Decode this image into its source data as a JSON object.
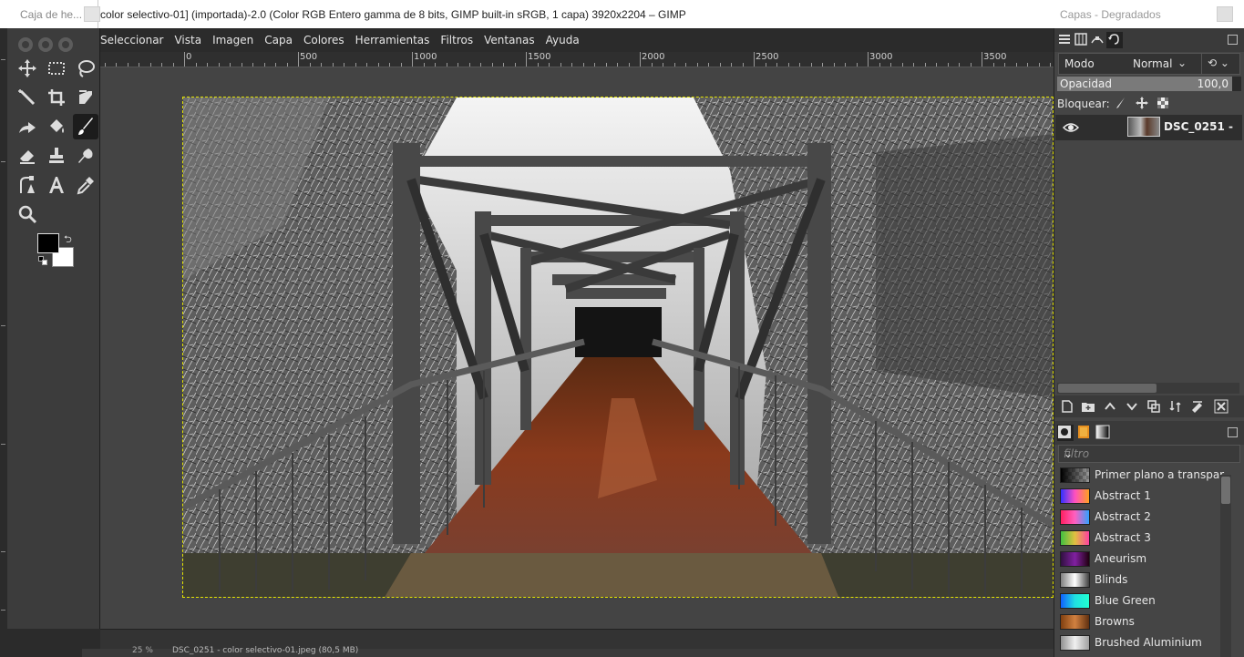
{
  "window": {
    "title": "color selectivo-01] (importada)-2.0 (Color RGB Entero gamma de 8 bits, GIMP built-in sRGB, 1 capa) 3920x2204 – GIMP",
    "toolbox_title": "Caja de he...",
    "dock_title": "Capas - Degradados"
  },
  "menu": [
    "Seleccionar",
    "Vista",
    "Imagen",
    "Capa",
    "Colores",
    "Herramientas",
    "Filtros",
    "Ventanas",
    "Ayuda"
  ],
  "tools": [
    {
      "name": "move-tool-icon"
    },
    {
      "name": "rect-select-tool-icon"
    },
    {
      "name": "free-select-tool-icon"
    },
    {
      "name": "fuzzy-select-tool-icon"
    },
    {
      "name": "crop-tool-icon"
    },
    {
      "name": "transform-tool-icon"
    },
    {
      "name": "warp-tool-icon"
    },
    {
      "name": "bucket-fill-tool-icon"
    },
    {
      "name": "paintbrush-tool-icon"
    },
    {
      "name": "eraser-tool-icon"
    },
    {
      "name": "clone-tool-icon"
    },
    {
      "name": "smudge-tool-icon"
    },
    {
      "name": "paths-tool-icon"
    },
    {
      "name": "text-tool-icon"
    },
    {
      "name": "color-picker-tool-icon"
    },
    {
      "name": "zoom-tool-icon"
    }
  ],
  "colors": {
    "foreground": "#000000",
    "background": "#ffffff",
    "selection_border": "#e5e500"
  },
  "ruler": {
    "labels": [
      "0",
      "500",
      "1000",
      "1500",
      "2000",
      "2500",
      "3000",
      "3500"
    ]
  },
  "status": {
    "zoom": "25 %",
    "text": "DSC_0251 - color selectivo-01.jpeg (80,5 MB)"
  },
  "layers": {
    "mode_label": "Modo",
    "mode_value": "Normal",
    "opacity_label": "Opacidad",
    "opacity_value": "100,0",
    "opacity_fraction": 1.0,
    "lock_label": "Bloquear:",
    "items": [
      {
        "name": "DSC_0251 -",
        "visible": true
      }
    ]
  },
  "gradients": {
    "filter_placeholder": "filtro",
    "items": [
      {
        "name": "Primer plano a transpar",
        "colors": [
          "#000000",
          "#666666"
        ]
      },
      {
        "name": "Abstract 1",
        "colors": [
          "#3030ff",
          "#ff50c0",
          "#ffa020"
        ]
      },
      {
        "name": "Abstract 2",
        "colors": [
          "#ff2060",
          "#ff60c0",
          "#30a0ff"
        ]
      },
      {
        "name": "Abstract 3",
        "colors": [
          "#40c040",
          "#e0c040",
          "#ff40a0"
        ]
      },
      {
        "name": "Aneurism",
        "colors": [
          "#301040",
          "#8020a0",
          "#200010"
        ]
      },
      {
        "name": "Blinds",
        "colors": [
          "#808080",
          "#ffffff",
          "#404040"
        ]
      },
      {
        "name": "Blue Green",
        "colors": [
          "#1060ff",
          "#20e0e0",
          "#20ffd0"
        ]
      },
      {
        "name": "Browns",
        "colors": [
          "#804010",
          "#d08040",
          "#603010"
        ]
      },
      {
        "name": "Brushed Aluminium",
        "colors": [
          "#909090",
          "#f0f0f0",
          "#a0a0a0"
        ]
      }
    ]
  }
}
